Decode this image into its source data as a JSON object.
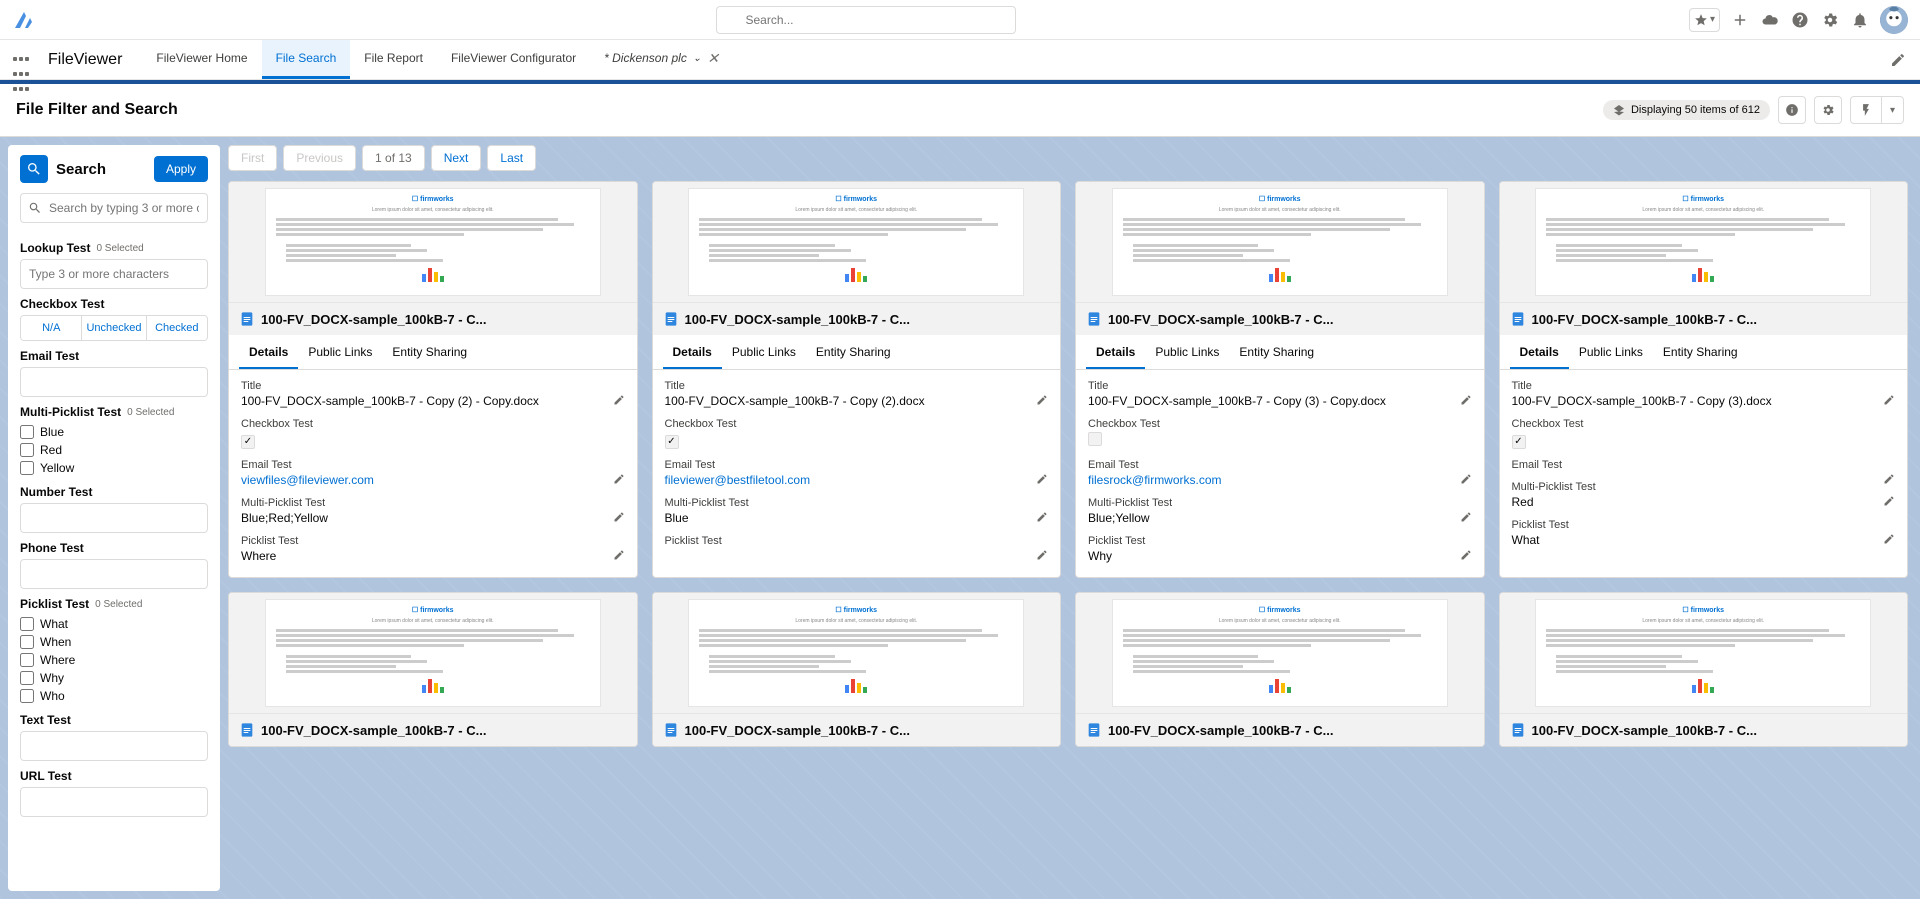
{
  "global_search_placeholder": "Search...",
  "app_name": "FileViewer",
  "nav": {
    "items": [
      "FileViewer Home",
      "File Search",
      "File Report",
      "FileViewer Configurator"
    ],
    "active": "File Search",
    "workspace": "* Dickenson plc"
  },
  "page": {
    "title": "File Filter and Search",
    "display_text": "Displaying 50 items of 612"
  },
  "sidebar": {
    "title": "Search",
    "apply": "Apply",
    "search_placeholder": "Search by typing 3 or more characters",
    "filters": {
      "lookup": {
        "label": "Lookup Test",
        "count": "0 Selected",
        "placeholder": "Type 3 or more characters"
      },
      "checkbox": {
        "label": "Checkbox Test",
        "options": [
          "N/A",
          "Unchecked",
          "Checked"
        ]
      },
      "email": {
        "label": "Email Test"
      },
      "multipicklist": {
        "label": "Multi-Picklist Test",
        "count": "0 Selected",
        "options": [
          "Blue",
          "Red",
          "Yellow"
        ]
      },
      "number": {
        "label": "Number Test"
      },
      "phone": {
        "label": "Phone Test"
      },
      "picklist": {
        "label": "Picklist Test",
        "count": "0 Selected",
        "options": [
          "What",
          "When",
          "Where",
          "Why",
          "Who"
        ]
      },
      "text": {
        "label": "Text Test"
      },
      "url": {
        "label": "URL Test"
      }
    }
  },
  "pager": {
    "first": "First",
    "prev": "Previous",
    "pos": "1 of 13",
    "next": "Next",
    "last": "Last"
  },
  "card_tabs": [
    "Details",
    "Public Links",
    "Entity Sharing"
  ],
  "field_labels": {
    "title": "Title",
    "checkbox": "Checkbox Test",
    "email": "Email Test",
    "multi": "Multi-Picklist Test",
    "picklist": "Picklist Test"
  },
  "cards": [
    {
      "name": "100-FV_DOCX-sample_100kB-7 - C...",
      "title": "100-FV_DOCX-sample_100kB-7 - Copy (2) - Copy.docx",
      "checkbox": true,
      "email": "viewfiles@fileviewer.com",
      "multi": "Blue;Red;Yellow",
      "picklist": "Where"
    },
    {
      "name": "100-FV_DOCX-sample_100kB-7 - C...",
      "title": "100-FV_DOCX-sample_100kB-7 - Copy (2).docx",
      "checkbox": true,
      "email": "fileviewer@bestfiletool.com",
      "multi": "Blue",
      "picklist": ""
    },
    {
      "name": "100-FV_DOCX-sample_100kB-7 - C...",
      "title": "100-FV_DOCX-sample_100kB-7 - Copy (3) - Copy.docx",
      "checkbox": false,
      "email": "filesrock@firmworks.com",
      "multi": "Blue;Yellow",
      "picklist": "Why"
    },
    {
      "name": "100-FV_DOCX-sample_100kB-7 - C...",
      "title": "100-FV_DOCX-sample_100kB-7 - Copy (3).docx",
      "checkbox": true,
      "email": "",
      "multi": "Red",
      "picklist": "What"
    }
  ],
  "thumb_brand": "☐ firmworks"
}
